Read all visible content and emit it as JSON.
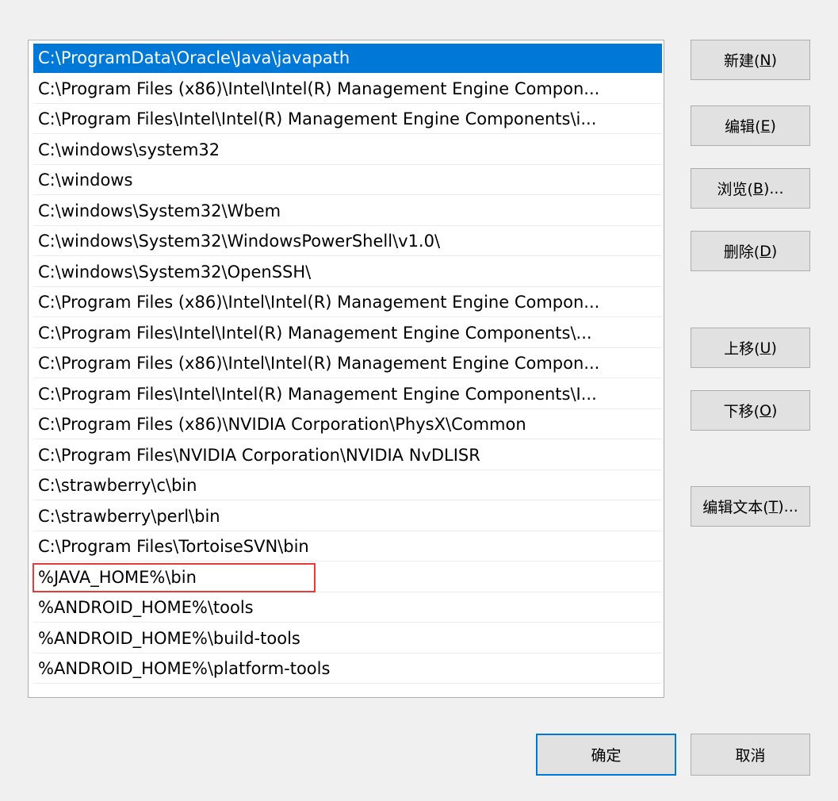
{
  "path_list": {
    "items": [
      "C:\\ProgramData\\Oracle\\Java\\javapath",
      "C:\\Program Files (x86)\\Intel\\Intel(R) Management Engine Compon...",
      "C:\\Program Files\\Intel\\Intel(R) Management Engine Components\\i...",
      "C:\\windows\\system32",
      "C:\\windows",
      "C:\\windows\\System32\\Wbem",
      "C:\\windows\\System32\\WindowsPowerShell\\v1.0\\",
      "C:\\windows\\System32\\OpenSSH\\",
      "C:\\Program Files (x86)\\Intel\\Intel(R) Management Engine Compon...",
      "C:\\Program Files\\Intel\\Intel(R) Management Engine Components\\...",
      "C:\\Program Files (x86)\\Intel\\Intel(R) Management Engine Compon...",
      "C:\\Program Files\\Intel\\Intel(R) Management Engine Components\\I...",
      "C:\\Program Files (x86)\\NVIDIA Corporation\\PhysX\\Common",
      "C:\\Program Files\\NVIDIA Corporation\\NVIDIA NvDLISR",
      "C:\\strawberry\\c\\bin",
      "C:\\strawberry\\perl\\bin",
      "C:\\Program Files\\TortoiseSVN\\bin",
      "%JAVA_HOME%\\bin",
      "%ANDROID_HOME%\\tools",
      "%ANDROID_HOME%\\build-tools",
      "%ANDROID_HOME%\\platform-tools"
    ],
    "selected_index": 0,
    "highlighted_index": 17
  },
  "buttons": {
    "new": {
      "label": "新建(",
      "key": "N",
      "suffix": ")"
    },
    "edit": {
      "label": "编辑(",
      "key": "E",
      "suffix": ")"
    },
    "browse": {
      "label": "浏览(",
      "key": "B",
      "suffix": ")..."
    },
    "delete": {
      "label": "删除(",
      "key": "D",
      "suffix": ")"
    },
    "move_up": {
      "label": "上移(",
      "key": "U",
      "suffix": ")"
    },
    "move_down": {
      "label": "下移(",
      "key": "O",
      "suffix": ")"
    },
    "edit_text": {
      "label": "编辑文本(",
      "key": "T",
      "suffix": ")..."
    },
    "ok": {
      "label": "确定"
    },
    "cancel": {
      "label": "取消"
    }
  },
  "colors": {
    "selection": "#0078d7",
    "highlight_border": "#e83a3a",
    "default_button_border": "#0078d7"
  }
}
